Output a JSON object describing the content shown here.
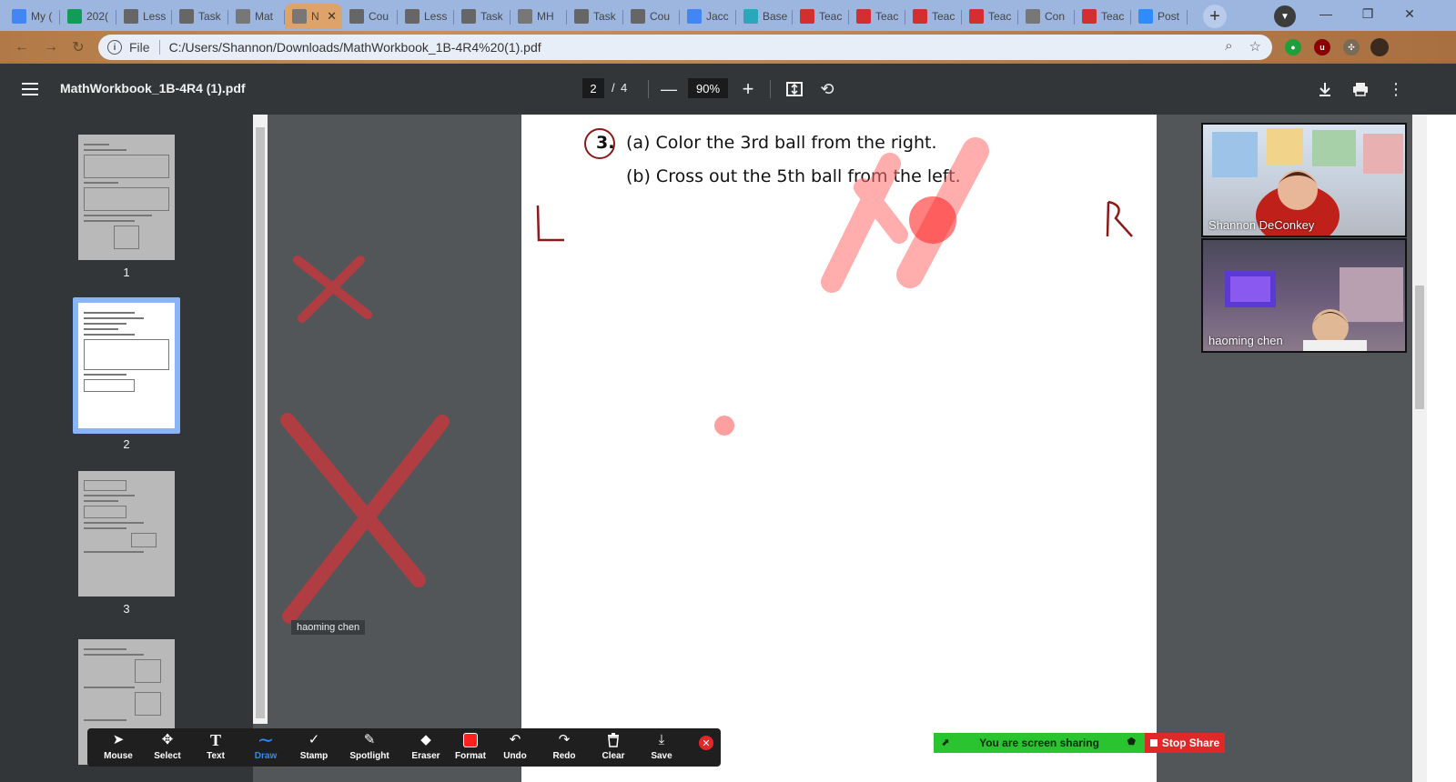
{
  "browser": {
    "tabs": [
      {
        "label": "My (",
        "icon": "google-drive-icon",
        "color": "#4285f4"
      },
      {
        "label": "202(",
        "icon": "google-sheets-icon",
        "color": "#0f9d58"
      },
      {
        "label": "Less",
        "icon": "lesson-icon",
        "color": "#666666"
      },
      {
        "label": "Task",
        "icon": "task-icon",
        "color": "#666666"
      },
      {
        "label": "Mat",
        "icon": "globe-icon",
        "color": "#777777"
      },
      {
        "label": "N",
        "icon": "globe-icon",
        "color": "#777777",
        "active": true
      },
      {
        "label": "Cou",
        "icon": "lesson-icon",
        "color": "#666666"
      },
      {
        "label": "Less",
        "icon": "lesson-icon",
        "color": "#666666"
      },
      {
        "label": "Task",
        "icon": "task-icon",
        "color": "#666666"
      },
      {
        "label": "MH",
        "icon": "globe-icon",
        "color": "#777777"
      },
      {
        "label": "Task",
        "icon": "task-icon",
        "color": "#666666"
      },
      {
        "label": "Cou",
        "icon": "lesson-icon",
        "color": "#666666"
      },
      {
        "label": "Jacc",
        "icon": "google-docs-icon",
        "color": "#4285f4"
      },
      {
        "label": "Base",
        "icon": "base-icon",
        "color": "#2aa7b8"
      },
      {
        "label": "Teac",
        "icon": "teacher-icon",
        "color": "#d32f2f"
      },
      {
        "label": "Teac",
        "icon": "teacher-icon",
        "color": "#d32f2f"
      },
      {
        "label": "Teac",
        "icon": "teacher-icon",
        "color": "#d32f2f"
      },
      {
        "label": "Teac",
        "icon": "teacher-icon",
        "color": "#d32f2f"
      },
      {
        "label": "Con",
        "icon": "globe-icon",
        "color": "#777777"
      },
      {
        "label": "Teac",
        "icon": "teacher-icon",
        "color": "#d32f2f"
      },
      {
        "label": "Post",
        "icon": "zoom-icon",
        "color": "#2d8cff"
      }
    ],
    "address_chip": "File",
    "url": "C:/Users/Shannon/Downloads/MathWorkbook_1B-4R4%20(1).pdf"
  },
  "pdf_toolbar": {
    "title": "MathWorkbook_1B-4R4 (1).pdf",
    "current_page": "2",
    "page_separator": "/",
    "total_pages": "4",
    "zoom": "90%"
  },
  "sidebar": {
    "thumbnails": [
      {
        "number": "1"
      },
      {
        "number": "2",
        "selected": true
      },
      {
        "number": "3"
      }
    ]
  },
  "worksheet": {
    "question_number": "3.",
    "line_a": "(a)  Color the 3rd ball from the right.",
    "line_b": "(b)  Cross out the 5th ball from the left.",
    "left_mark": "L",
    "right_mark": "R"
  },
  "annotation_author": "haoming chen",
  "participants": [
    {
      "name": "Shannon DeConkey"
    },
    {
      "name": "haoming chen"
    }
  ],
  "annotate_toolbar": {
    "tools": [
      {
        "label": "Mouse",
        "icon": "mouse-pointer-icon"
      },
      {
        "label": "Select",
        "icon": "move-arrows-icon"
      },
      {
        "label": "Text",
        "icon": "text-t-icon"
      },
      {
        "label": "Draw",
        "icon": "squiggle-icon",
        "active": true
      },
      {
        "label": "Stamp",
        "icon": "checkmark-icon"
      },
      {
        "label": "Spotlight",
        "icon": "spotlight-wand-icon"
      },
      {
        "label": "Eraser",
        "icon": "eraser-icon"
      },
      {
        "label": "Format",
        "icon": "red-swatch-icon"
      },
      {
        "label": "Undo",
        "icon": "undo-icon"
      },
      {
        "label": "Redo",
        "icon": "redo-icon"
      },
      {
        "label": "Clear",
        "icon": "trash-icon"
      },
      {
        "label": "Save",
        "icon": "save-download-icon"
      }
    ],
    "accent": "#2d8cff"
  },
  "screen_share": {
    "status": "You are screen sharing",
    "stop_label": "Stop Share",
    "status_color": "#2ac431",
    "stop_color": "#e02828"
  }
}
